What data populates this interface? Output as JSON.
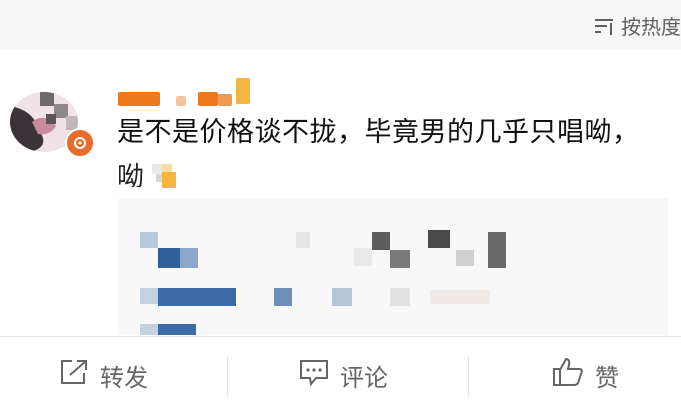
{
  "sort": {
    "icon": "sort-lines-icon",
    "label": "按热度"
  },
  "comment": {
    "avatar": "blurred-avatar",
    "badge_icon": "verified-badge-icon",
    "text": "是不是价格谈不拢，毕竟男的几乎只唱呦，",
    "tail_text": "呦",
    "tail_icon": "emoji-icon"
  },
  "actions": {
    "repost": {
      "icon": "repost-icon",
      "label": "转发"
    },
    "comment": {
      "icon": "comment-bubble-icon",
      "label": "评论"
    },
    "like": {
      "icon": "thumbs-up-icon",
      "label": "赞"
    }
  },
  "colors": {
    "background": "#ffffff",
    "sort_bar": "#f7f7f7",
    "name_orange": "#ee7a20",
    "name_yellow": "#f3b53d",
    "badge": "#ea6c2d",
    "text": "#111111",
    "action_text": "#666666"
  }
}
